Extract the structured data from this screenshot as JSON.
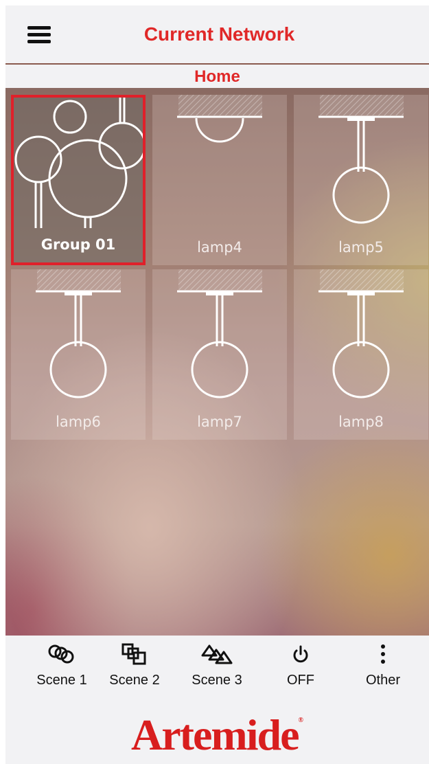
{
  "header": {
    "title": "Current Network",
    "menu_icon": "hamburger-menu-icon"
  },
  "subheader": {
    "title": "Home"
  },
  "tiles": [
    {
      "label": "Group 01",
      "type": "group",
      "selected": true
    },
    {
      "label": "lamp4",
      "type": "lamp-ceiling",
      "selected": false
    },
    {
      "label": "lamp5",
      "type": "lamp-pendant",
      "selected": false
    },
    {
      "label": "lamp6",
      "type": "lamp-pendant",
      "selected": false
    },
    {
      "label": "lamp7",
      "type": "lamp-pendant",
      "selected": false
    },
    {
      "label": "lamp8",
      "type": "lamp-pendant",
      "selected": false
    }
  ],
  "actions": [
    {
      "label": "Scene 1",
      "icon": "scene1-icon"
    },
    {
      "label": "Scene 2",
      "icon": "scene2-icon"
    },
    {
      "label": "Scene 3",
      "icon": "scene3-icon"
    },
    {
      "label": "OFF",
      "icon": "power-icon"
    },
    {
      "label": "Other",
      "icon": "more-vertical-icon"
    }
  ],
  "brand": {
    "logo": "Artemide",
    "color": "#d81e1e",
    "accent": "#e02828"
  }
}
